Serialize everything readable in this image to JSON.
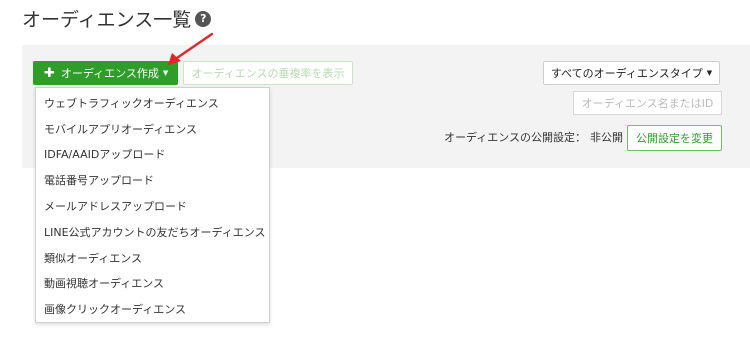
{
  "page": {
    "title": "オーディエンス一覧",
    "help_icon": "question-circle-icon"
  },
  "toolbar": {
    "create_label": "オーディエンス作成",
    "create_icon": "plus-icon",
    "rate_label": "オーディエンスの垂複率を表示",
    "type_filter": "すべてのオーディエンスタイプ",
    "search_placeholder": "オーディエンス名またはID",
    "publish_label": "オーディエンスの公開設定：",
    "publish_value": "非公開",
    "publish_button": "公開設定を変更"
  },
  "dropdown": {
    "items": [
      "ウェブトラフィックオーディエンス",
      "モバイルアプリオーディエンス",
      "IDFA/AAIDアップロード",
      "電話番号アップロード",
      "メールアドレスアップロード",
      "LINE公式アカウントの友だちオーディエンス",
      "類似オーディエンス",
      "動画視聴オーディエンス",
      "画像クリックオーディエンス"
    ]
  },
  "colors": {
    "primary_green": "#2e9d2a",
    "annotation_arrow": "#e0262b",
    "panel_bg": "#f3f3f3"
  }
}
